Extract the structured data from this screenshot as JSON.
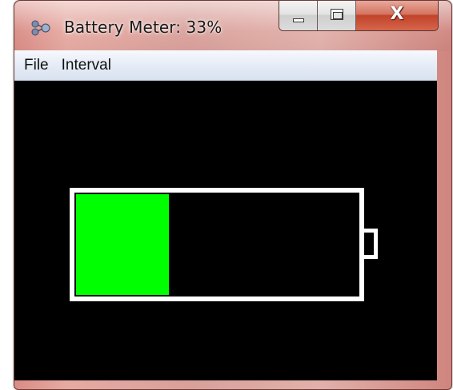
{
  "window": {
    "title": "Battery Meter: 33%",
    "icon": "app-battery-icon",
    "controls": {
      "minimize_icon": "minimize-icon",
      "maximize_icon": "maximize-icon",
      "close_label": "X"
    }
  },
  "menu": {
    "items": [
      {
        "label": "File"
      },
      {
        "label": "Interval"
      }
    ]
  },
  "battery": {
    "level_percent": 33,
    "fill_color": "#00ff00",
    "outline_color": "#ffffff",
    "background_color": "#000000"
  }
}
